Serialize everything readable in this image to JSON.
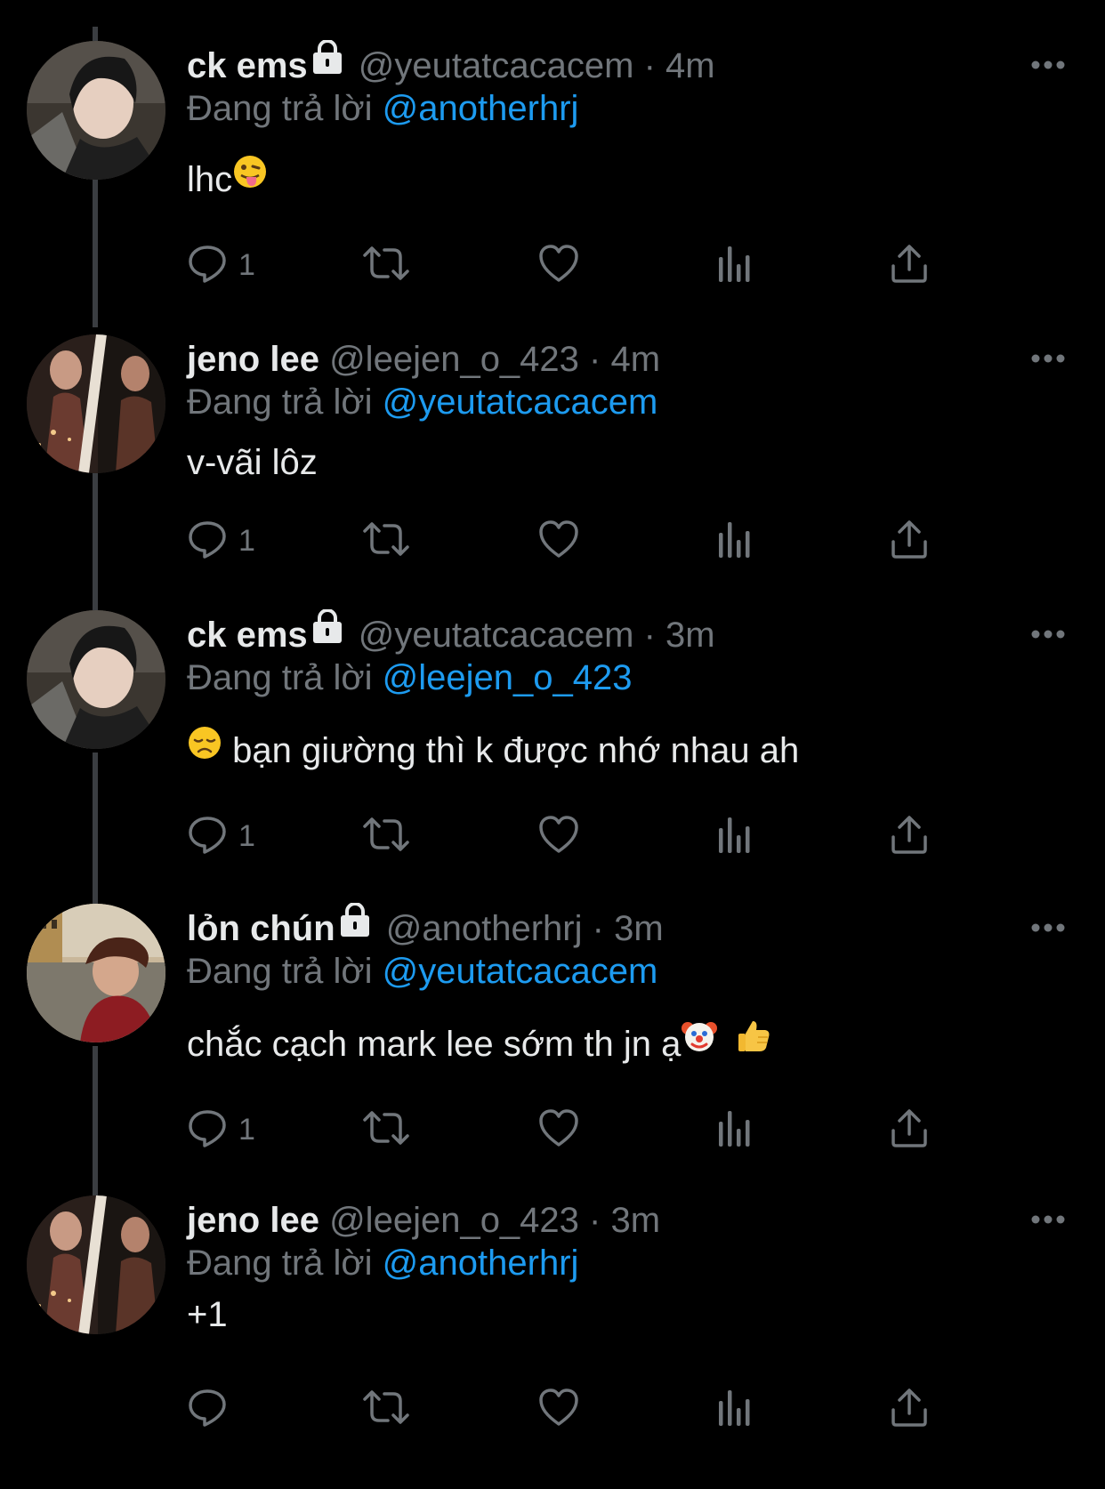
{
  "colors": {
    "background": "#000000",
    "primary_text": "#e7e9ea",
    "secondary_text": "#71767b",
    "mention": "#1d9bf0",
    "thread_line": "#3a3d41"
  },
  "reply_prefix": "Đang trả lời",
  "tweets": [
    {
      "display_name": "ck ems",
      "locked": true,
      "handle": "@yeutatcacacem",
      "separator": "·",
      "time": "4m",
      "reply_to": "@anotherhrj",
      "text_before": "lhc",
      "text_after": "",
      "emojis": [
        "tongue-face-emoji"
      ],
      "reply_count": "1"
    },
    {
      "display_name": "jeno lee",
      "locked": false,
      "handle": "@leejen_o_423",
      "separator": "·",
      "time": "4m",
      "reply_to": "@yeutatcacacem",
      "text_before": "v-vãi lôz",
      "text_after": "",
      "emojis": [],
      "reply_count": "1"
    },
    {
      "display_name": "ck ems",
      "locked": true,
      "handle": "@yeutatcacacem",
      "separator": "·",
      "time": "3m",
      "reply_to": "@leejen_o_423",
      "text_before": "",
      "text_after": " bạn giường thì k được nhớ nhau ah",
      "emojis": [
        "disappointed-face-emoji"
      ],
      "reply_count": "1"
    },
    {
      "display_name": "lỏn chún",
      "locked": true,
      "handle": "@anotherhrj",
      "separator": "·",
      "time": "3m",
      "reply_to": "@yeutatcacacem",
      "text_before": "chắc cạch mark lee sớm th jn ạ",
      "text_after": "",
      "emojis": [
        "clown-face-emoji",
        "thumbs-up-emoji"
      ],
      "reply_count": "1"
    },
    {
      "display_name": "jeno lee",
      "locked": false,
      "handle": "@leejen_o_423",
      "separator": "·",
      "time": "3m",
      "reply_to": "@anotherhrj",
      "text_before": "+1",
      "text_after": "",
      "emojis": [],
      "reply_count": ""
    }
  ],
  "icons": {
    "lock": "lock-icon",
    "more": "more-dots-icon",
    "reply": "reply-bubble-icon",
    "retweet": "retweet-icon",
    "like": "heart-icon",
    "views": "views-bar-chart-icon",
    "share": "share-upload-icon"
  }
}
